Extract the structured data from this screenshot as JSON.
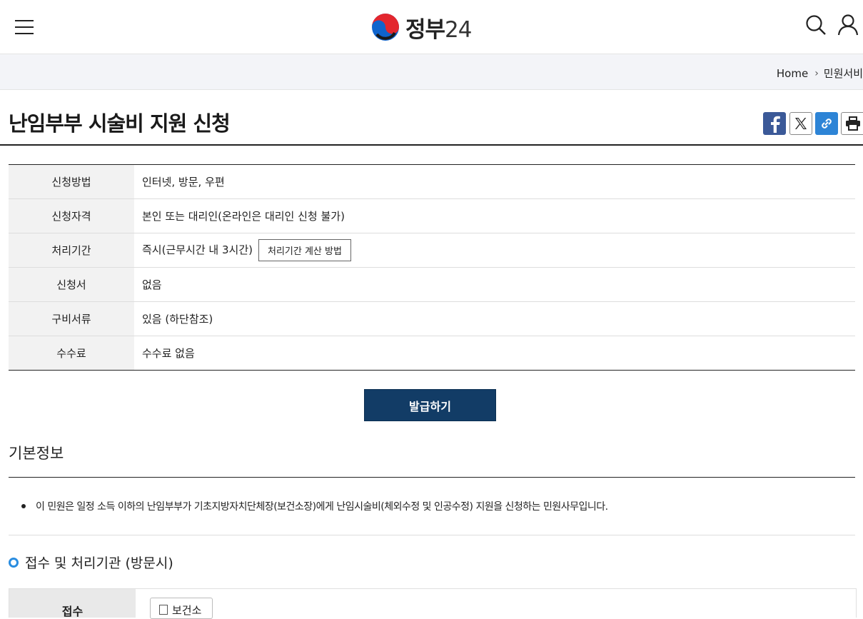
{
  "header": {
    "menu_icon": "hamburger-menu-icon",
    "logo_text": "정부",
    "logo_num": "24",
    "search_icon": "search-icon",
    "user_icon": "user-icon"
  },
  "breadcrumb": {
    "home": "Home",
    "separator": "›",
    "current": "민원서비"
  },
  "page": {
    "title": "난임부부 시술비 지원 신청"
  },
  "share": {
    "facebook_icon": "facebook-icon",
    "x_icon": "x-twitter-icon",
    "link_icon": "link-icon",
    "print_icon": "print-icon"
  },
  "info_table": {
    "rows": [
      {
        "label": "신청방법",
        "value": "인터넷, 방문, 우편"
      },
      {
        "label": "신청자격",
        "value": "본인 또는 대리인(온라인은 대리인 신청 불가)"
      },
      {
        "label": "처리기간",
        "value": "즉시(근무시간 내 3시간)",
        "button": "처리기간 계산 방법"
      },
      {
        "label": "신청서",
        "value": "없음"
      },
      {
        "label": "구비서류",
        "value": "있음 (하단참조)"
      },
      {
        "label": "수수료",
        "value": "수수료 없음"
      }
    ]
  },
  "issue_button": "발급하기",
  "basic_info": {
    "title": "기본정보",
    "description": "이 민원은 일정 소득 이하의 난임부부가 기초지방자치단체장(보건소장)에게 난임시술비(체외수정 및 인공수정) 지원을 신청하는 민원사무입니다."
  },
  "processing": {
    "title": "접수 및 처리기관 (방문시)",
    "reception_label": "접수",
    "org_button": "보건소"
  },
  "colors": {
    "primary_button": "#123c66",
    "accent_blue": "#2a8de0",
    "facebook": "#3b5998",
    "breadcrumb_bg": "#f3f4f8"
  }
}
